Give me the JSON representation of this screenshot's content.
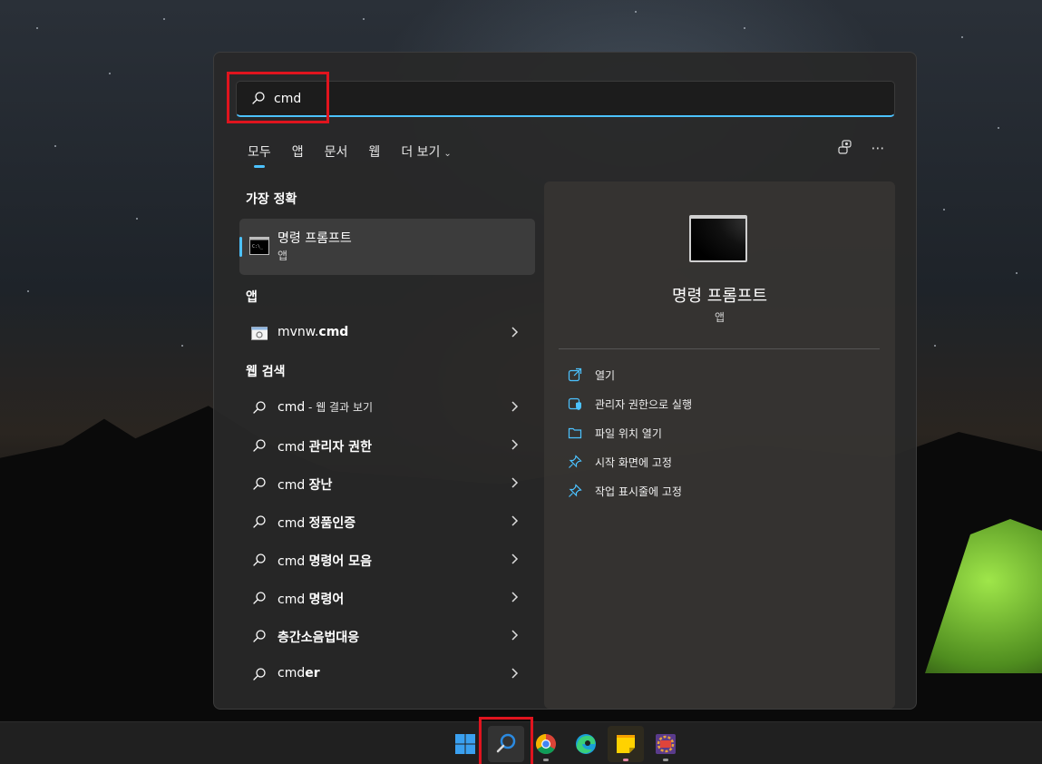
{
  "search": {
    "value": "cmd",
    "placeholder": ""
  },
  "tabs": [
    {
      "label": "모두",
      "active": true
    },
    {
      "label": "앱"
    },
    {
      "label": "문서"
    },
    {
      "label": "웹"
    },
    {
      "label": "더 보기"
    }
  ],
  "best_match": {
    "heading": "가장 정확",
    "name": "명령 프롬프트",
    "type": "앱",
    "icon": "command-prompt-icon"
  },
  "apps": {
    "heading": "앱",
    "items": [
      {
        "name_prefix": "mvnw.",
        "name_bold": "cmd",
        "icon": "batch-file-icon"
      }
    ]
  },
  "web": {
    "heading": "웹 검색",
    "items": [
      {
        "prefix": "cmd",
        "suffix": " - 웹 결과 보기",
        "bold": false
      },
      {
        "prefix": "cmd ",
        "suffix": "관리자 권한",
        "bold": true
      },
      {
        "prefix": "cmd ",
        "suffix": "장난",
        "bold": true
      },
      {
        "prefix": "cmd ",
        "suffix": "정품인증",
        "bold": true
      },
      {
        "prefix": "cmd ",
        "suffix": "명령어 모음",
        "bold": true
      },
      {
        "prefix": "cmd ",
        "suffix": "명령어",
        "bold": true
      },
      {
        "prefix": "",
        "suffix": "층간소음법대응",
        "bold": true
      },
      {
        "prefix": "cmd",
        "suffix": "er",
        "bold": true
      }
    ]
  },
  "detail": {
    "title": "명령 프롬프트",
    "subtitle": "앱",
    "actions": [
      {
        "label": "열기",
        "icon": "open-external-icon"
      },
      {
        "label": "관리자 권한으로 실행",
        "icon": "shield-admin-icon"
      },
      {
        "label": "파일 위치 열기",
        "icon": "folder-icon"
      },
      {
        "label": "시작 화면에 고정",
        "icon": "pin-icon"
      },
      {
        "label": "작업 표시줄에 고정",
        "icon": "pin-icon"
      }
    ]
  },
  "taskbar": {
    "items": [
      "windows-start-icon",
      "search-icon",
      "chrome-icon",
      "edge-browser-icon",
      "sticky-notes-icon",
      "ide-app-icon"
    ]
  },
  "colors": {
    "accent": "#4cc2ff",
    "highlight_box": "#e0141e",
    "panel_bg": "#282828"
  }
}
